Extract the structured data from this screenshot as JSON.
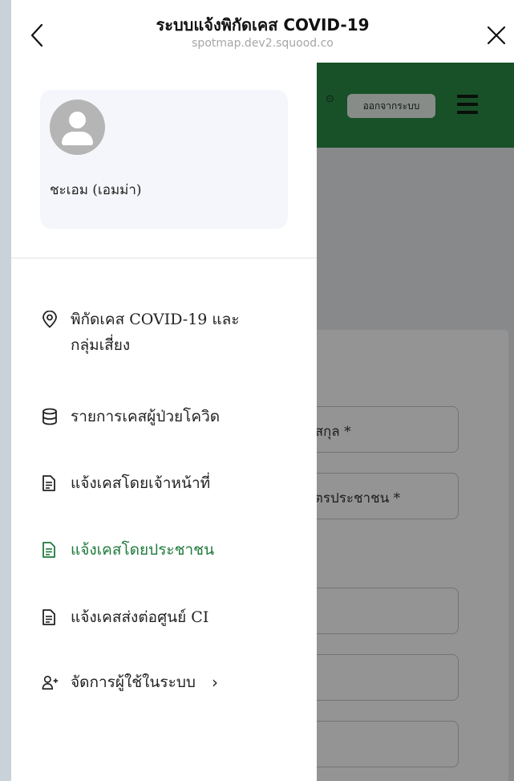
{
  "browser": {
    "title": "ระบบแจ้งพิกัดเคส COVID-19",
    "url": "spotmap.dev2.squood.co"
  },
  "app": {
    "logout_label": "ออกจากระบบ",
    "fields": [
      {
        "text": "นสกุล *"
      },
      {
        "text": "บัตรประชาชน *"
      },
      {
        "text": ""
      },
      {
        "text": ""
      },
      {
        "text": ""
      }
    ]
  },
  "drawer": {
    "profile": {
      "name": "ชะเอม (เอมม่า)"
    },
    "menu": [
      {
        "label_line1": "พิกัดเคส COVID-19 และ",
        "label_line2": "กลุ่มเสี่ยง",
        "icon": "location-pin-icon"
      },
      {
        "label": "รายการเคสผู้ป่วยโควิด",
        "icon": "database-icon"
      },
      {
        "label": "แจ้งเคสโดยเจ้าหน้าที่",
        "icon": "document-icon"
      },
      {
        "label": "แจ้งเคสโดยประชาชน",
        "icon": "document-icon",
        "active": true
      },
      {
        "label": "แจ้งเคสส่งต่อศูนย์ CI",
        "icon": "document-icon"
      },
      {
        "label": "จัดการผู้ใช้ในระบบ",
        "icon": "add-user-icon",
        "chevron": "›"
      }
    ]
  },
  "colors": {
    "accent_green": "#1e7a3a",
    "header_green": "#2a8a45"
  }
}
